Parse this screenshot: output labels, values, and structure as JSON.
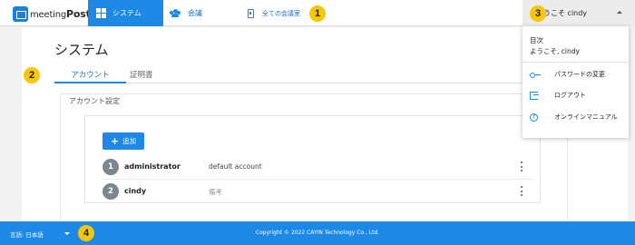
{
  "header": {
    "logo": {
      "text_prefix": "meeting",
      "text_bold": "Post",
      "text_plus": "+"
    },
    "nav": {
      "system": "システム",
      "meeting": "会議",
      "all_rooms": "全ての会議室"
    },
    "user_label": "ようこそ cindy"
  },
  "page": {
    "title": "システム",
    "tabs": [
      {
        "label": "アカウント",
        "active": true
      },
      {
        "label": "証明書",
        "active": false
      }
    ],
    "section_title": "アカウント設定",
    "add_button": "追加",
    "accounts": [
      {
        "num": "1",
        "name": "administrator",
        "note": "default account"
      },
      {
        "num": "2",
        "name": "cindy",
        "note": "備考"
      }
    ]
  },
  "user_menu": {
    "heading": "目次",
    "welcome": "ようこそ, cindy",
    "items": [
      {
        "label": "パスワードの変更",
        "icon": "key-icon"
      },
      {
        "label": "ログアウト",
        "icon": "logout-icon"
      },
      {
        "label": "オンラインマニュアル",
        "icon": "help-icon"
      }
    ]
  },
  "footer": {
    "language": "言語: 日本語",
    "copyright": "Copyright © 2022 CAYIN Technology Co., Ltd."
  },
  "annotations": [
    "1",
    "2",
    "3",
    "4"
  ],
  "colors": {
    "primary": "#1e88e5",
    "badge": "#f7c800",
    "footer": "#1e88e5"
  }
}
